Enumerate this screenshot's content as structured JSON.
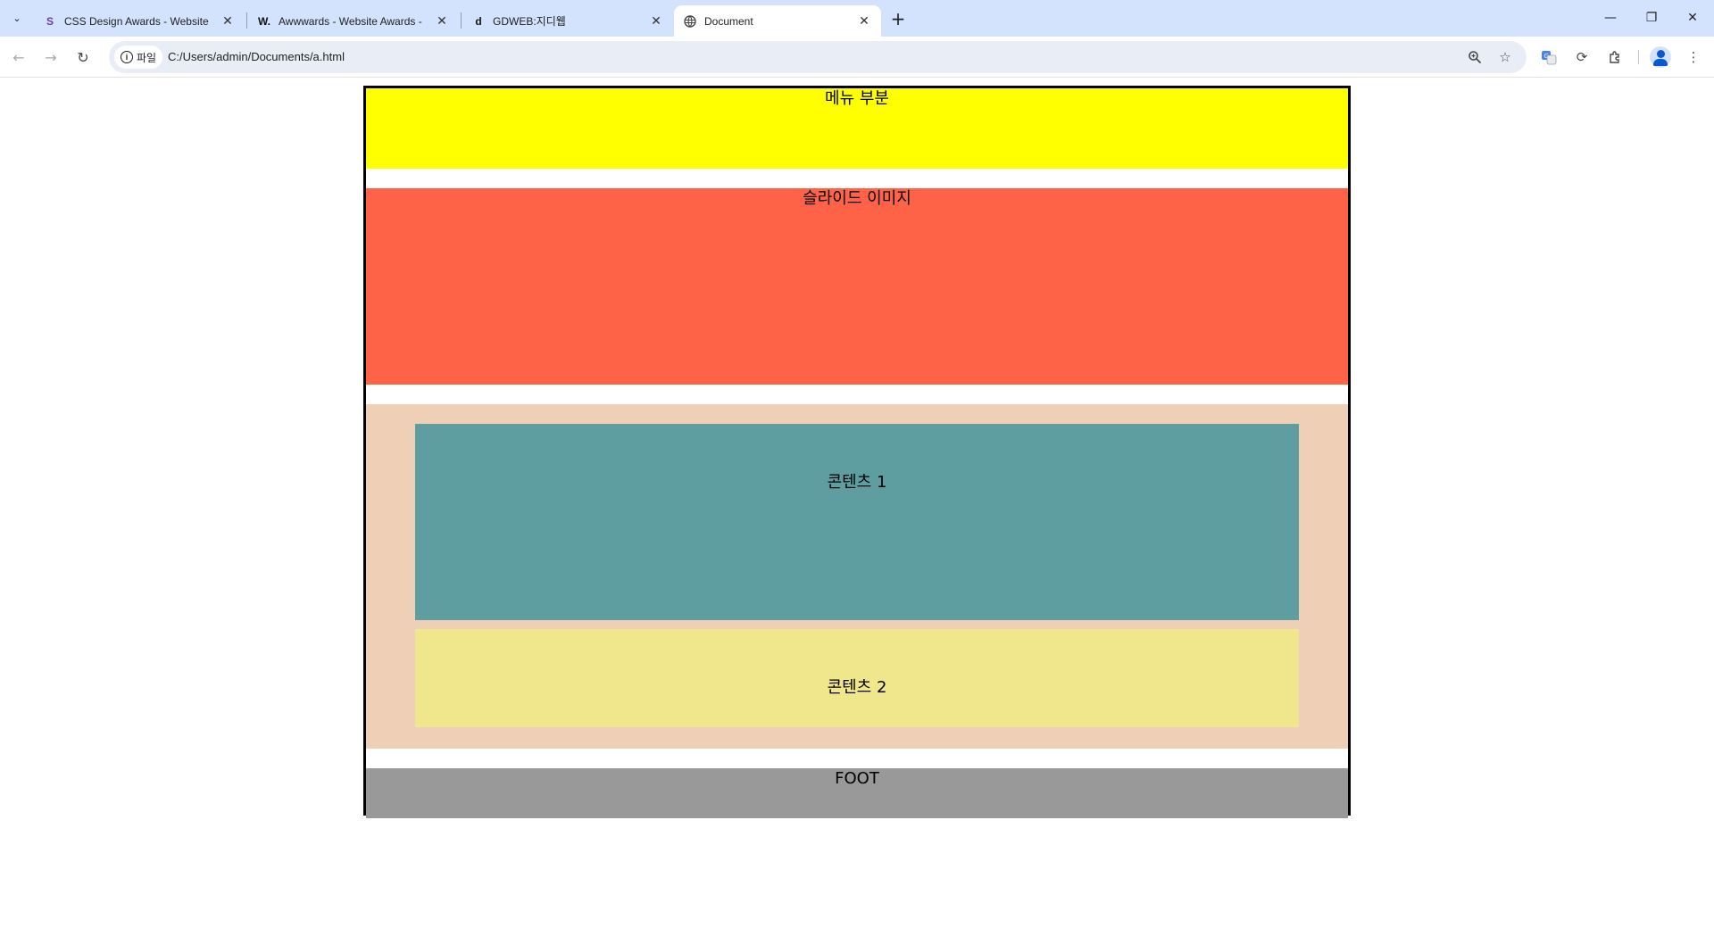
{
  "browser": {
    "tabs": [
      {
        "title": "CSS Design Awards - Website",
        "favicon": "css-design-awards-logo"
      },
      {
        "title": "Awwwards - Website Awards -",
        "favicon": "awwwards-logo"
      },
      {
        "title": "GDWEB:지디웹",
        "favicon": "gdweb-logo"
      },
      {
        "title": "Document",
        "favicon": "globe-icon",
        "active": true
      }
    ],
    "site_chip_label": "파일",
    "url": "C:/Users/admin/Documents/a.html"
  },
  "page": {
    "menu_label": "메뉴 부분",
    "slide_label": "슬라이드 이미지",
    "content1_label": "콘텐츠 1",
    "content2_label": "콘텐츠 2",
    "foot_label": "FOOT"
  },
  "colors": {
    "menu": "#ffff00",
    "slide": "#ff6347",
    "contents_bg": "#efd0b7",
    "content1": "#5f9ea0",
    "content2": "#f0e68c",
    "foot": "#999999",
    "tabstrip": "#d3e3fd"
  }
}
